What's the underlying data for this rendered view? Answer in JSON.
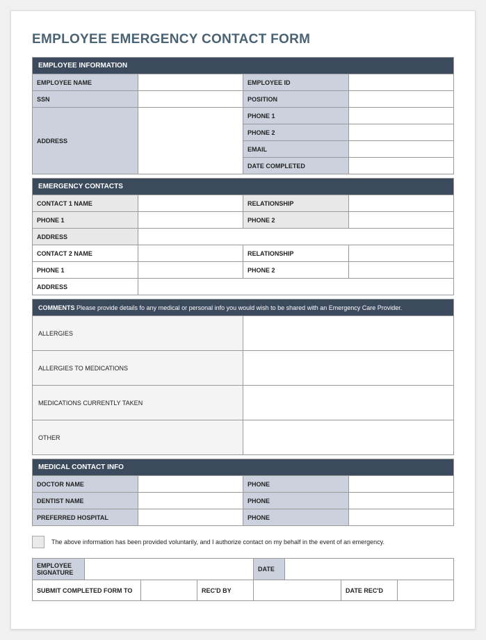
{
  "title": "EMPLOYEE EMERGENCY CONTACT FORM",
  "sections": {
    "employee_info": {
      "header": "EMPLOYEE INFORMATION",
      "employee_name": "EMPLOYEE NAME",
      "employee_id": "EMPLOYEE ID",
      "ssn": "SSN",
      "position": "POSITION",
      "address": "ADDRESS",
      "phone1": "PHONE 1",
      "phone2": "PHONE 2",
      "email": "EMAIL",
      "date_completed": "DATE COMPLETED"
    },
    "emergency_contacts": {
      "header": "EMERGENCY CONTACTS",
      "contact1_name": "CONTACT 1 NAME",
      "contact2_name": "CONTACT 2 NAME",
      "relationship": "RELATIONSHIP",
      "phone1": "PHONE 1",
      "phone2": "PHONE 2",
      "address": "ADDRESS"
    },
    "comments": {
      "header_bold": "COMMENTS",
      "header_text": " Please provide details fo any medical or personal info you would wish to be shared with an Emergency Care Provider.",
      "allergies": "ALLERGIES",
      "allergies_meds": "ALLERGIES TO MEDICATIONS",
      "medications": "MEDICATIONS CURRENTLY TAKEN",
      "other": "OTHER"
    },
    "medical": {
      "header": "MEDICAL CONTACT INFO",
      "doctor": "DOCTOR NAME",
      "dentist": "DENTIST NAME",
      "hospital": "PREFERRED HOSPITAL",
      "phone": "PHONE"
    },
    "authorization": {
      "text": "The above information has been provided voluntarily, and I authorize contact on my behalf in the event of an emergency."
    },
    "signoff": {
      "employee_signature": "EMPLOYEE SIGNATURE",
      "date": "DATE",
      "submit_to": "SUBMIT COMPLETED FORM TO",
      "recd_by": "REC'D BY",
      "date_recd": "DATE REC'D"
    }
  }
}
